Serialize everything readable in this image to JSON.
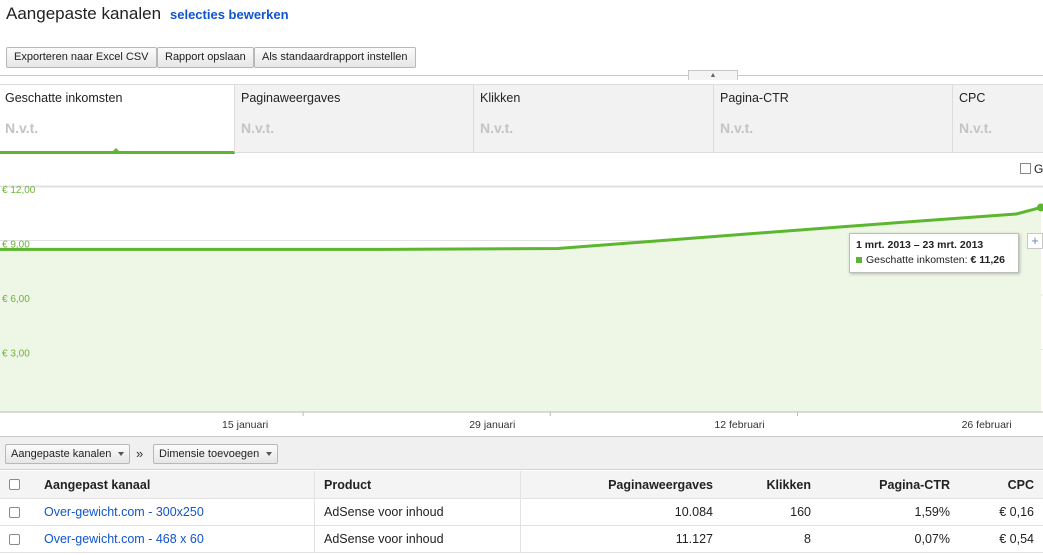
{
  "header": {
    "title": "Aangepaste kanalen",
    "edit_link": "selecties bewerken"
  },
  "toolbar": {
    "export_label": "Exporteren naar Excel CSV",
    "save_label": "Rapport opslaan",
    "default_label": "Als standaardrapport instellen",
    "collapse_icon": "▲"
  },
  "metrics": [
    {
      "name": "Geschatte inkomsten",
      "value": "N.v.t."
    },
    {
      "name": "Paginaweergaves",
      "value": "N.v.t."
    },
    {
      "name": "Klikken",
      "value": "N.v.t."
    },
    {
      "name": "Pagina-CTR",
      "value": "N.v.t."
    },
    {
      "name": "CPC",
      "value": "N.v.t."
    }
  ],
  "compare_label": "G",
  "chart_data": {
    "type": "area",
    "y_ticks": [
      "€ 12,00",
      "€ 9,00",
      "€ 6,00",
      "€ 3,00"
    ],
    "ylim": [
      0,
      12
    ],
    "x_ticks": [
      "15 januari",
      "29 januari",
      "12 februari",
      "26 februari"
    ],
    "series": [
      {
        "name": "Geschatte inkomsten",
        "color": "#5cb630",
        "points": [
          [
            0,
            8.95
          ],
          [
            31,
            8.95
          ],
          [
            45,
            9.0
          ],
          [
            68,
            10.2
          ],
          [
            82,
            10.9
          ],
          [
            84,
            11.26
          ]
        ]
      }
    ],
    "x_domain": [
      0,
      84
    ]
  },
  "tooltip": {
    "date": "1 mrt. 2013 – 23 mrt. 2013",
    "label": "Geschatte inkomsten:",
    "value": "€ 11,26"
  },
  "zoom_icon": "+",
  "dimension_bar": {
    "primary_dim": "Aangepaste kanalen",
    "separator": "»",
    "add_dim": "Dimensie toevoegen"
  },
  "table": {
    "headers": [
      "Aangepast kanaal",
      "Product",
      "Paginaweergaves",
      "Klikken",
      "Pagina-CTR",
      "CPC"
    ],
    "rows": [
      [
        "Over-gewicht.com - 300x250",
        "AdSense voor inhoud",
        "10.084",
        "160",
        "1,59%",
        "€ 0,16"
      ],
      [
        "Over-gewicht.com - 468 x 60",
        "AdSense voor inhoud",
        "11.127",
        "8",
        "0,07%",
        "€ 0,54"
      ]
    ]
  }
}
